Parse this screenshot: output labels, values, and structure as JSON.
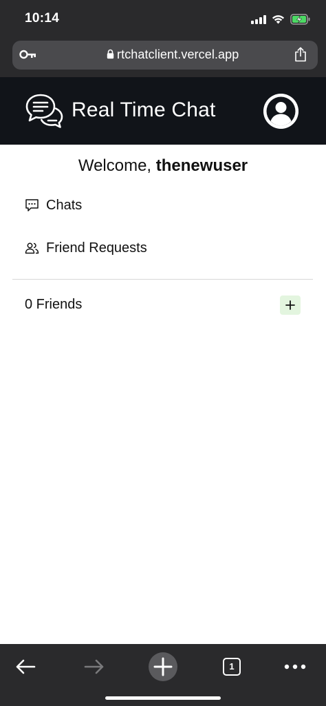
{
  "status_bar": {
    "time": "10:14",
    "icons": [
      "signal-icon",
      "wifi-icon",
      "battery-charging-icon"
    ]
  },
  "browser": {
    "url": "rtchatclient.vercel.app",
    "icons": [
      "key-icon",
      "lock-icon",
      "share-icon"
    ],
    "toolbar": {
      "tab_count": "1",
      "icons": [
        "back-arrow-icon",
        "forward-arrow-icon",
        "new-tab-plus-icon",
        "tabs-icon",
        "more-icon"
      ]
    }
  },
  "header": {
    "title": "Real Time Chat",
    "logo_icon": "chat-bubbles-icon",
    "avatar_icon": "user-avatar-icon"
  },
  "main": {
    "welcome_prefix": "Welcome, ",
    "username": "thenewuser",
    "nav": [
      {
        "label": "Chats",
        "icon": "chat-icon"
      },
      {
        "label": "Friend Requests",
        "icon": "users-icon"
      }
    ],
    "friends_label": "0 Friends",
    "add_icon": "plus-icon"
  },
  "colors": {
    "browser_chrome": "#2a2a2c",
    "url_bar": "#4a4a4d",
    "app_header": "#111419",
    "add_button_bg": "#e3f5df",
    "battery_green": "#4cd964"
  }
}
